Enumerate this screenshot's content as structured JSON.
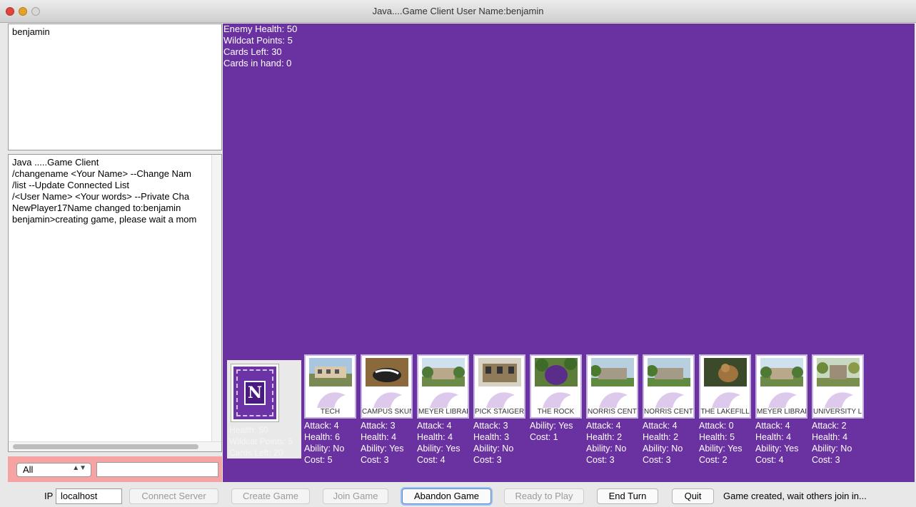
{
  "window": {
    "title": "Java....Game Client User Name:benjamin"
  },
  "users": [
    "benjamin"
  ],
  "chat": {
    "lines": [
      "Java .....Game Client",
      "/changename <Your Name>  --Change Nam",
      "/list --Update Connected List",
      "/<User Name> <Your words>  --Private Cha",
      "NewPlayer17Name changed to:benjamin",
      "benjamin>creating game, please wait a mom"
    ],
    "recipient": "All",
    "input_value": ""
  },
  "enemy": {
    "health": "Enemy Health: 50",
    "wildcat_points": "Wildcat Points: 5",
    "cards_left": "Cards Left: 30",
    "cards_in_hand": "Cards in hand: 0"
  },
  "player": {
    "health": "Health: 50",
    "wildcat_points": "Wildcat Points: 5",
    "cards_left": "Cards Left: 20"
  },
  "deck": {
    "logo": "N"
  },
  "hand": [
    {
      "name": "TECH",
      "stats": [
        "Attack: 4",
        "Health: 6",
        "Ability: No",
        "Cost: 5"
      ]
    },
    {
      "name": "CAMPUS SKUNK",
      "stats": [
        "Attack: 3",
        "Health: 4",
        "Ability: Yes",
        "Cost: 3"
      ]
    },
    {
      "name": "MEYER LIBRARY",
      "stats": [
        "Attack: 4",
        "Health: 4",
        "Ability: Yes",
        "Cost: 4"
      ]
    },
    {
      "name": "PICK STAIGER",
      "stats": [
        "Attack: 3",
        "Health: 3",
        "Ability: No",
        "Cost: 3"
      ]
    },
    {
      "name": "THE ROCK",
      "stats": [
        "Ability: Yes",
        "Cost: 1"
      ]
    },
    {
      "name": "NORRIS CENTER",
      "stats": [
        "Attack: 4",
        "Health: 2",
        "Ability: No",
        "Cost: 3"
      ]
    },
    {
      "name": "NORRIS CENTER",
      "stats": [
        "Attack: 4",
        "Health: 2",
        "Ability: No",
        "Cost: 3"
      ]
    },
    {
      "name": "THE LAKEFILL",
      "stats": [
        "Attack: 0",
        "Health: 5",
        "Ability: Yes",
        "Cost: 2"
      ]
    },
    {
      "name": "MEYER LIBRARY",
      "stats": [
        "Attack: 4",
        "Health: 4",
        "Ability: Yes",
        "Cost: 4"
      ]
    },
    {
      "name": "UNIVERSITY LIBRARY",
      "stats": [
        "Attack: 2",
        "Health: 4",
        "Ability: No",
        "Cost: 3"
      ]
    }
  ],
  "toolbar": {
    "ip_label": "IP",
    "ip_value": "localhost",
    "connect": "Connect Server",
    "create": "Create Game",
    "join": "Join Game",
    "abandon": "Abandon Game",
    "ready": "Ready to Play",
    "end_turn": "End Turn",
    "quit": "Quit",
    "status": "Game created, wait others join in..."
  },
  "colors": {
    "board": "#6a31a0",
    "chat_controls": "#f5a3a3"
  }
}
